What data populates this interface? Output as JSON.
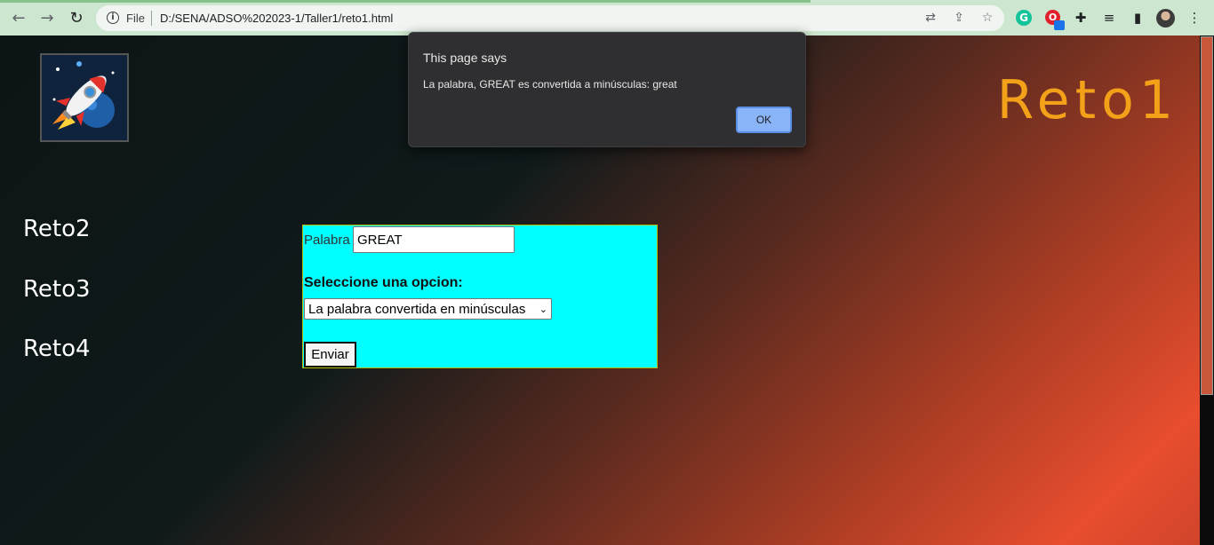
{
  "browser": {
    "url_scheme_label": "File",
    "url": "D:/SENA/ADSO%202023-1/Taller1/reto1.html",
    "icons": [
      "back-arrow",
      "forward-arrow",
      "reload",
      "info",
      "translate",
      "share",
      "bookmark-star",
      "grammarly",
      "extension-red",
      "puzzle",
      "media",
      "side-panel",
      "profile-avatar",
      "menu-kebab"
    ]
  },
  "page": {
    "site_title": "Reto1",
    "nav": [
      "Reto2",
      "Reto3",
      "Reto4"
    ],
    "form": {
      "palabra_label": "Palabra",
      "palabra_value": "GREAT",
      "select_label": "Seleccione una opcion:",
      "select_value": "La palabra convertida en minúsculas",
      "submit_label": "Enviar",
      "background_color": "#00ffff"
    },
    "title_color": "#f4a11a"
  },
  "dialog": {
    "title": "This page says",
    "message": "La palabra, GREAT es convertida a minúsculas: great",
    "ok_label": "OK"
  }
}
